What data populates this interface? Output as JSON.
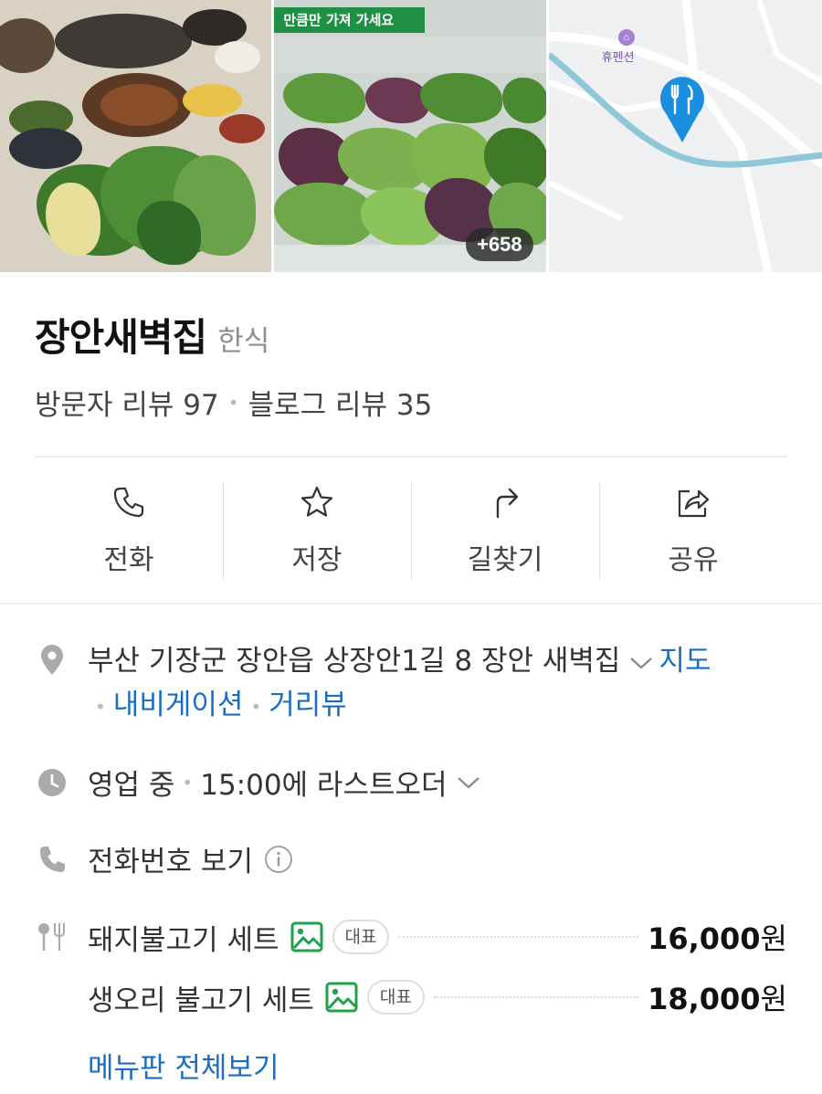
{
  "gallery": {
    "photo2_sign": "만큼만 가져 가세요",
    "photo_count": "+658",
    "map_label": "휴펜션"
  },
  "place": {
    "name": "장안새벽집",
    "category": "한식",
    "visitor_review_label": "방문자 리뷰 97",
    "blog_review_label": "블로그 리뷰 35"
  },
  "actions": [
    {
      "label": "전화",
      "icon": "phone-icon"
    },
    {
      "label": "저장",
      "icon": "star-icon"
    },
    {
      "label": "길찾기",
      "icon": "directions-icon"
    },
    {
      "label": "공유",
      "icon": "share-icon"
    }
  ],
  "address": {
    "text": "부산 기장군 장안읍 상장안1길 8 장안 새벽집",
    "map_link": "지도",
    "navigation_link": "내비게이션",
    "streetview_link": "거리뷰"
  },
  "hours": {
    "status": "영업 중",
    "last_order": "15:00에 라스트오더"
  },
  "phone": {
    "label": "전화번호 보기"
  },
  "menu": {
    "items": [
      {
        "name": "돼지불고기 세트",
        "badge": "대표",
        "price": "16,000",
        "unit": "원"
      },
      {
        "name": "생오리 불고기 세트",
        "badge": "대표",
        "price": "18,000",
        "unit": "원"
      }
    ],
    "more_label": "메뉴판 전체보기"
  },
  "colors": {
    "link": "#1a6ec2",
    "pin": "#1a8fe0",
    "photo_badge": "#1fa24a",
    "icon_gray": "#aaaaaa"
  }
}
